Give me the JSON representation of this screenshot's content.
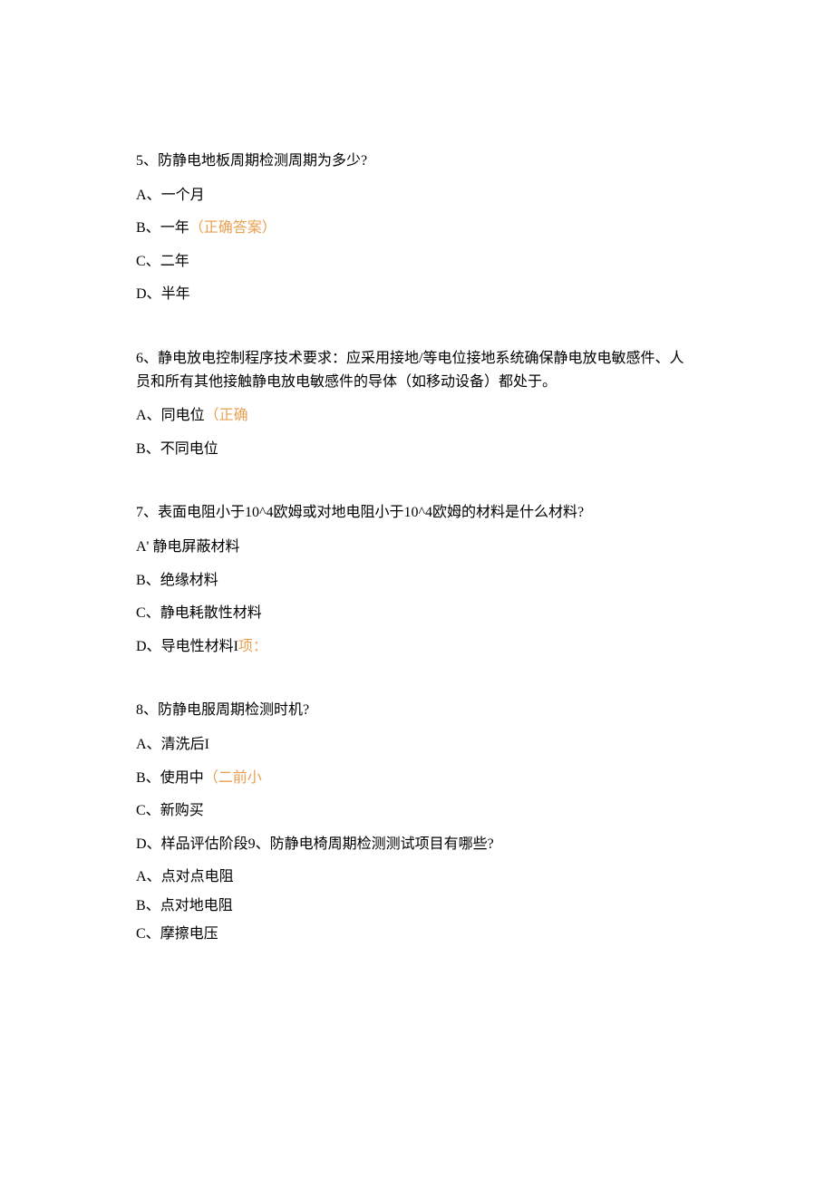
{
  "questions": [
    {
      "number": "5、",
      "text": "防静电地板周期检测周期为多少?",
      "options": [
        {
          "prefix": "A、",
          "text": "一个月",
          "mark": ""
        },
        {
          "prefix": "B、",
          "text": "一年",
          "mark": "（正确答案）"
        },
        {
          "prefix": "C、",
          "text": "二年",
          "mark": ""
        },
        {
          "prefix": "D、",
          "text": "半年",
          "mark": ""
        }
      ]
    },
    {
      "number": "6、",
      "text": "静电放电控制程序技术要求：应采用接地/等电位接地系统确保静电放电敏感件、人员和所有其他接触静电放电敏感件的导体（如移动设备）都处于。",
      "options": [
        {
          "prefix": "A、",
          "text": "同电位",
          "mark": "（正确"
        },
        {
          "prefix": "B、",
          "text": "不同电位",
          "mark": ""
        }
      ]
    },
    {
      "number": "7、",
      "text": "表面电阻小于10^4欧姆或对地电阻小于10^4欧姆的材料是什么材料?",
      "options": [
        {
          "prefix": "A' ",
          "text": "静电屏蔽材料",
          "mark": ""
        },
        {
          "prefix": "B、",
          "text": "绝缘材料",
          "mark": ""
        },
        {
          "prefix": "C、",
          "text": "静电耗散性材料",
          "mark": ""
        },
        {
          "prefix": "D、",
          "text": "导电性材料I",
          "mark": "项："
        }
      ]
    },
    {
      "number": "8、",
      "text": "防静电服周期检测时机?",
      "options": [
        {
          "prefix": "A、",
          "text": "清洗后I",
          "mark": ""
        },
        {
          "prefix": "B、",
          "text": "使用中",
          "mark": "（二前小"
        },
        {
          "prefix": "C、",
          "text": "新购买",
          "mark": ""
        },
        {
          "prefix": "D、",
          "text": "样品评估阶段9、防静电椅周期检测测试项目有哪些?",
          "mark": ""
        }
      ],
      "sub_options": [
        {
          "prefix": "A、",
          "text": "点对点电阻"
        },
        {
          "prefix": "B、",
          "text": "点对地电阻"
        },
        {
          "prefix": "C、",
          "text": "摩擦电压"
        }
      ]
    }
  ]
}
